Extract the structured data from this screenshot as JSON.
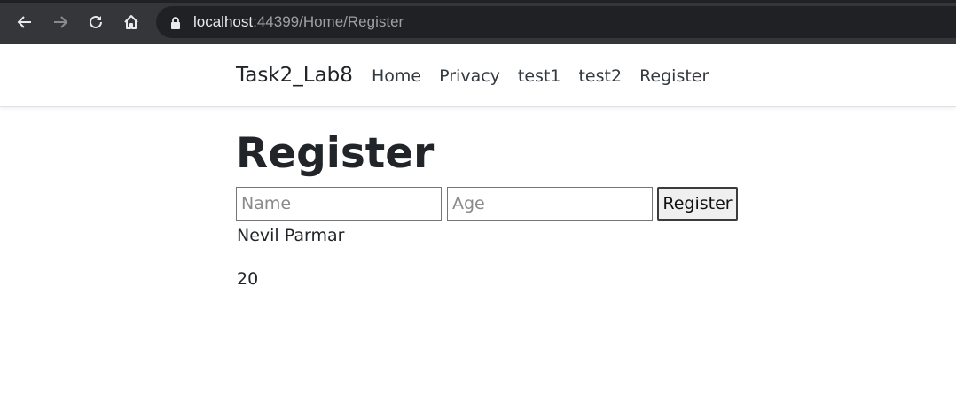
{
  "browser": {
    "url_host": "localhost",
    "url_rest": ":44399/Home/Register",
    "icons": [
      "back-icon",
      "forward-icon",
      "reload-icon",
      "home-icon",
      "lock-icon"
    ]
  },
  "navbar": {
    "brand": "Task2_Lab8",
    "links": [
      "Home",
      "Privacy",
      "test1",
      "test2",
      "Register"
    ]
  },
  "main": {
    "title": "Register",
    "name_placeholder": "Name",
    "age_placeholder": "Age",
    "button_label": "Register",
    "output_name": "Nevil Parmar",
    "output_age": "20"
  },
  "colors": {
    "chrome_bg": "#35363a",
    "omnibox_bg": "#202124",
    "text": "#212529"
  }
}
